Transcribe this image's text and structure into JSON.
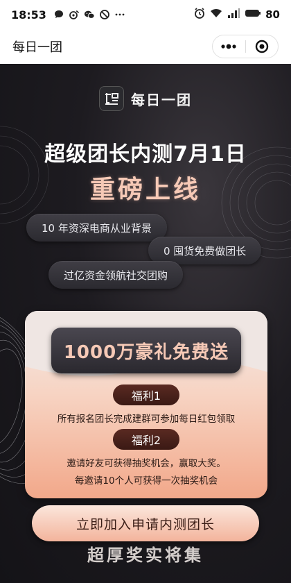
{
  "status_bar": {
    "time": "18:53",
    "battery": "80",
    "left_icons": [
      "chat-bubble-icon",
      "weibo-icon",
      "wechat-icon",
      "do-not-disturb-icon",
      "more-dots-icon"
    ],
    "right_icons": [
      "alarm-icon",
      "wifi-icon",
      "signal-4g-icon",
      "battery-icon"
    ]
  },
  "nav": {
    "title": "每日一团"
  },
  "hero": {
    "brand_name": "每日一团",
    "headline": "超级团长内测7月1日",
    "subheadline": "重磅上线",
    "pills": [
      "10 年资深电商从业背景",
      "0 囤货免费做团长",
      "过亿资金领航社交团购"
    ]
  },
  "card": {
    "banner": "1000万豪礼免费送",
    "perk1_tag": "福利1",
    "perk1_text": "所有报名团长完成建群可参加每日红包领取",
    "perk2_tag": "福利2",
    "perk2_text_line1": "邀请好友可获得抽奖机会，赢取大奖。",
    "perk2_text_line2": "每邀请10个人可获得一次抽奖机会"
  },
  "cta": {
    "label": "立即加入申请内测团长"
  },
  "footer": {
    "heading_partial": "超厚奖实将集"
  },
  "colors": {
    "accent_peach": "#f6c9b6",
    "dark_bg": "#1d1b20",
    "perk_tag": "#4a2019"
  }
}
